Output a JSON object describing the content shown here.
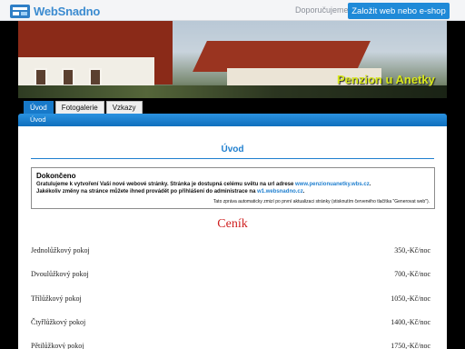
{
  "brand": {
    "name": "WebSnadno"
  },
  "top_nav": {
    "recommend_label": "Doporučujeme",
    "cta_label": "Založit web nebo e-shop"
  },
  "banner": {
    "title": "Penzion u Anetky"
  },
  "tabs": [
    {
      "label": "Úvod",
      "active": true
    },
    {
      "label": "Fotogalerie",
      "active": false
    },
    {
      "label": "Vzkazy",
      "active": false
    }
  ],
  "breadcrumb": "Úvod",
  "page": {
    "title": "Úvod"
  },
  "notice": {
    "heading": "Dokončeno",
    "line1_text": "Gratulujeme k vytvoření Vaší nové webové stránky. Stránka je dostupná celému světu na url adrese",
    "line1_link": "www.penzionuanetky.wbs.cz",
    "line2_text": "Jakékoliv změny na stránce můžete ihned provádět po přihlášení do administrace na",
    "line2_link": "w1.websnadno.cz",
    "footnote": "Tato zpráva automaticky zmizí po první aktualizaci stránky (stisknutím červeného tlačítka \"Generovat web\")."
  },
  "cenik": {
    "title": "Ceník",
    "items": [
      {
        "name": "Jednolůžkový pokoj",
        "price": "350,-Kč/noc"
      },
      {
        "name": "Dvoulůžkový pokoj",
        "price": "700,-Kč/noc"
      },
      {
        "name": "Třílůžkový pokoj",
        "price": "1050,-Kč/noc"
      },
      {
        "name": "Čtyřlůžkový pokoj",
        "price": "1400,-Kč/noc"
      },
      {
        "name": "Pětilůžkový pokoj",
        "price": "1750,-Kč/noc"
      }
    ]
  },
  "colors": {
    "accent": "#1f7fcf",
    "cta": "#1f8ad8",
    "banner_title": "#d8e81c",
    "cenik_title": "#cf1f1f"
  }
}
